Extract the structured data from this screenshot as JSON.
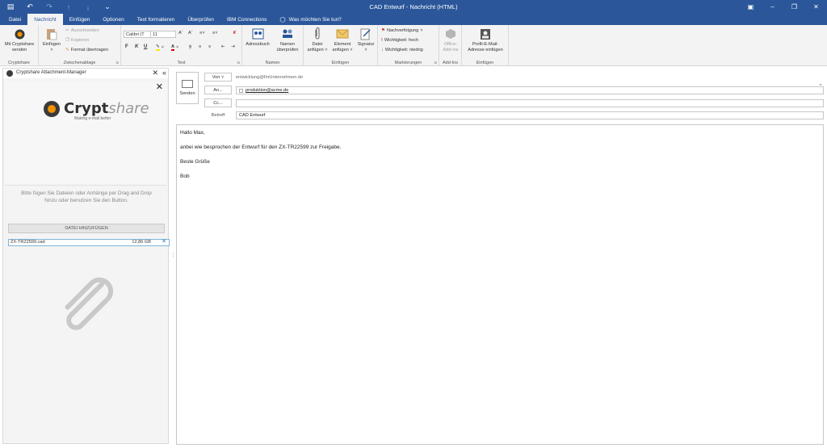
{
  "window": {
    "title": "CAD Entwurf - Nachricht (HTML)"
  },
  "tabs": [
    {
      "label": "Datei"
    },
    {
      "label": "Nachricht"
    },
    {
      "label": "Einfügen"
    },
    {
      "label": "Optionen"
    },
    {
      "label": "Text formatieren"
    },
    {
      "label": "Überprüfen"
    },
    {
      "label": "IBM Connections"
    },
    {
      "label": "Was möchten Sie tun?"
    }
  ],
  "ribbon": {
    "cryptshare": {
      "btn1": "Mit Cryptshare",
      "btn2": "senden",
      "group": "Cryptshare"
    },
    "clipboard": {
      "paste1": "Einfügen",
      "paste2": "",
      "cut": "Ausschneiden",
      "copy": "Kopieren",
      "format": "Format übertragen",
      "group": "Zwischenablage"
    },
    "text": {
      "font": "Calibri (T",
      "size": "11",
      "bold": "F",
      "italic": "K",
      "underline": "U",
      "group": "Text"
    },
    "names": {
      "addressbook": "Adressbuch",
      "check1": "Namen",
      "check2": "überprüfen",
      "group": "Namen"
    },
    "insert": {
      "file1": "Datei",
      "file2": "anfügen",
      "item1": "Element",
      "item2": "anfügen",
      "sig": "Signatur",
      "group": "Einfügen"
    },
    "tags": {
      "followup": "Nachverfolgung",
      "high": "Wichtigkeit: hoch",
      "low": "Wichtigkeit: niedrig",
      "group": "Markierungen"
    },
    "addins": {
      "office1": "Office-",
      "office2": "Add-ins",
      "group": "Add-Ins"
    },
    "profile": {
      "l1": "Profil-E-Mail-",
      "l2": "Adresse einfügen",
      "group": "Einfügen"
    }
  },
  "pane": {
    "title": "Cryptshare Attachment-Manager",
    "brand": "Crypt",
    "brand_suffix": "share",
    "tagline": "Making e-mail better",
    "hint": "Bitte fügen Sie Dateien oder Anhänge per Drag and Drop hinzu oder benutzen Sie den Button.",
    "add_button": "DATEI HINZUFÜGEN",
    "file": {
      "name": "ZX-TR22599.cad",
      "size": "12,86 GB"
    }
  },
  "compose": {
    "send": "Senden",
    "from_button": "Von",
    "from_value": "entwicklung@IhrUnternehmen.de",
    "to_button": "An...",
    "to_value": "produktion@acme.de",
    "cc_button": "Cc...",
    "subject_label": "Betreff",
    "subject_value": "CAD Entwurf",
    "body": [
      "Hallo Max,",
      "anbei wie besprochen der Entwurf für den ZX-TR22599 zur Freigabe.",
      "Beste Grüße",
      "Bob"
    ]
  }
}
